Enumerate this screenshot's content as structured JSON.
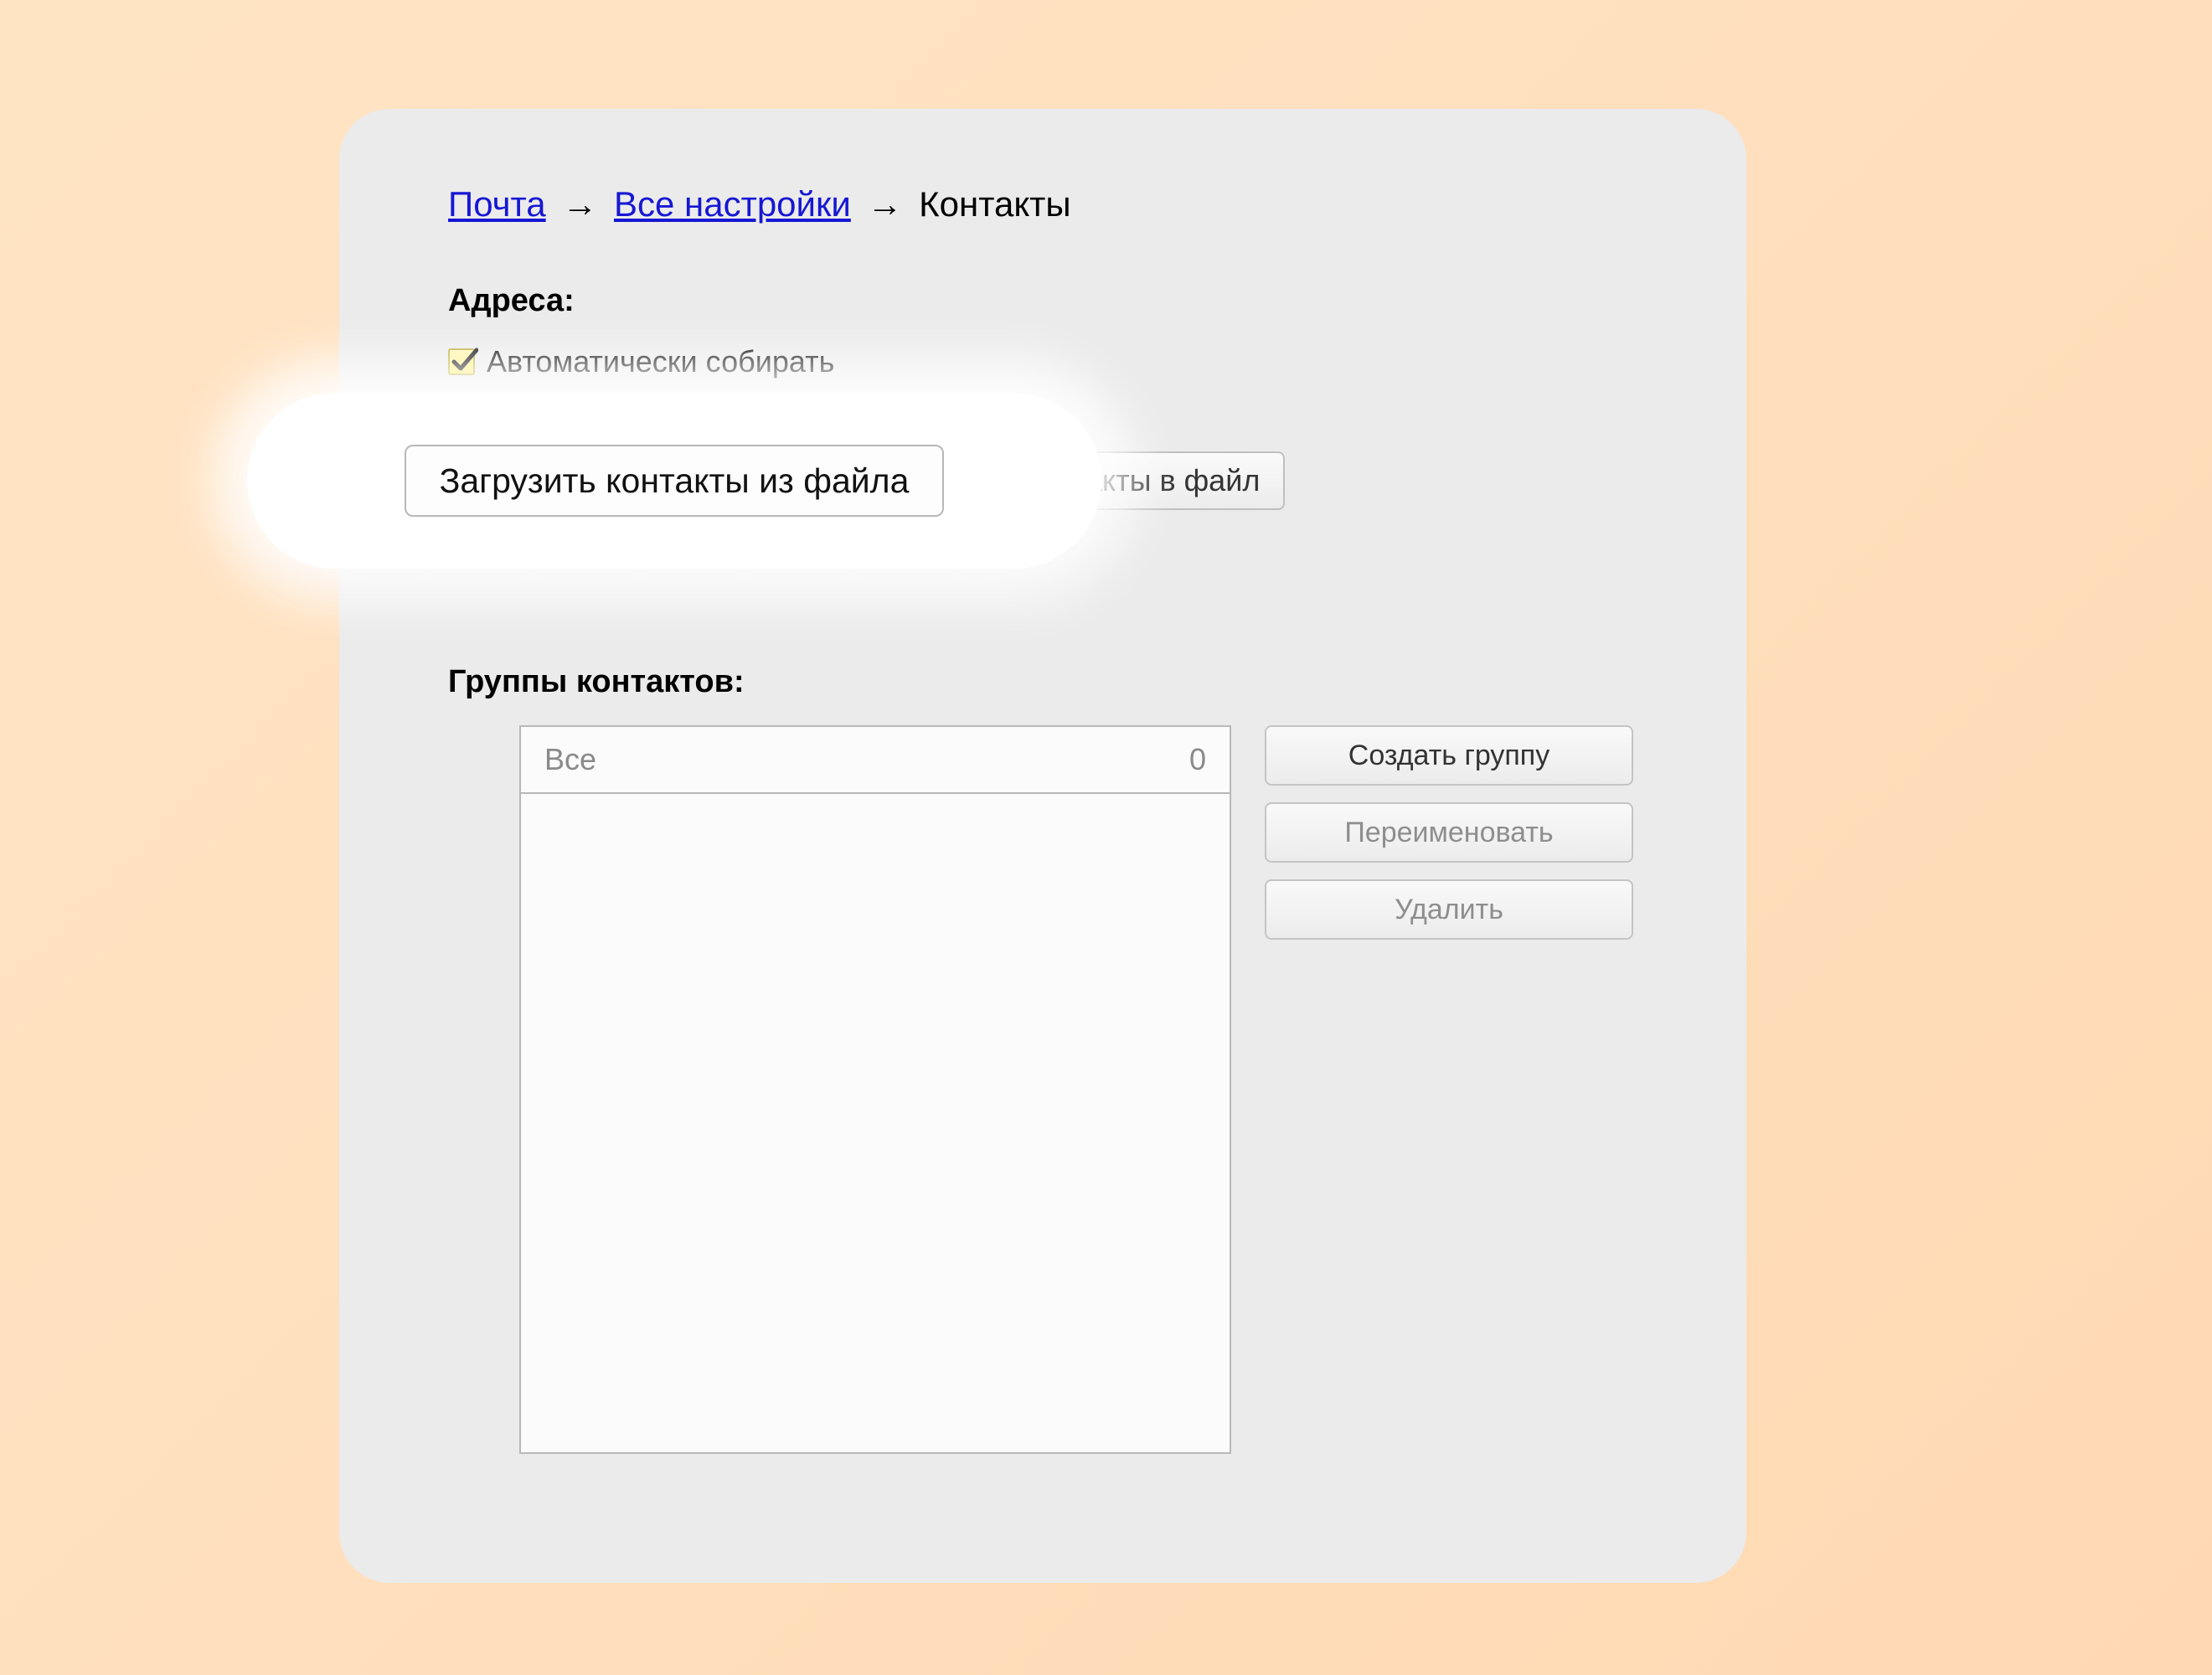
{
  "breadcrumb": {
    "mail": "Почта",
    "all_settings": "Все настройки",
    "contacts": "Контакты",
    "sep": "→"
  },
  "addresses": {
    "label": "Адреса:",
    "auto_collect": "Автоматически собирать"
  },
  "buttons": {
    "load_from_file": "Загрузить контакты из файла",
    "export_to_file_visible": "ь контакты в файл"
  },
  "groups": {
    "label": "Группы контактов:",
    "all_label": "Все",
    "all_count": "0",
    "create": "Создать группу",
    "rename": "Переименовать",
    "delete": "Удалить"
  }
}
